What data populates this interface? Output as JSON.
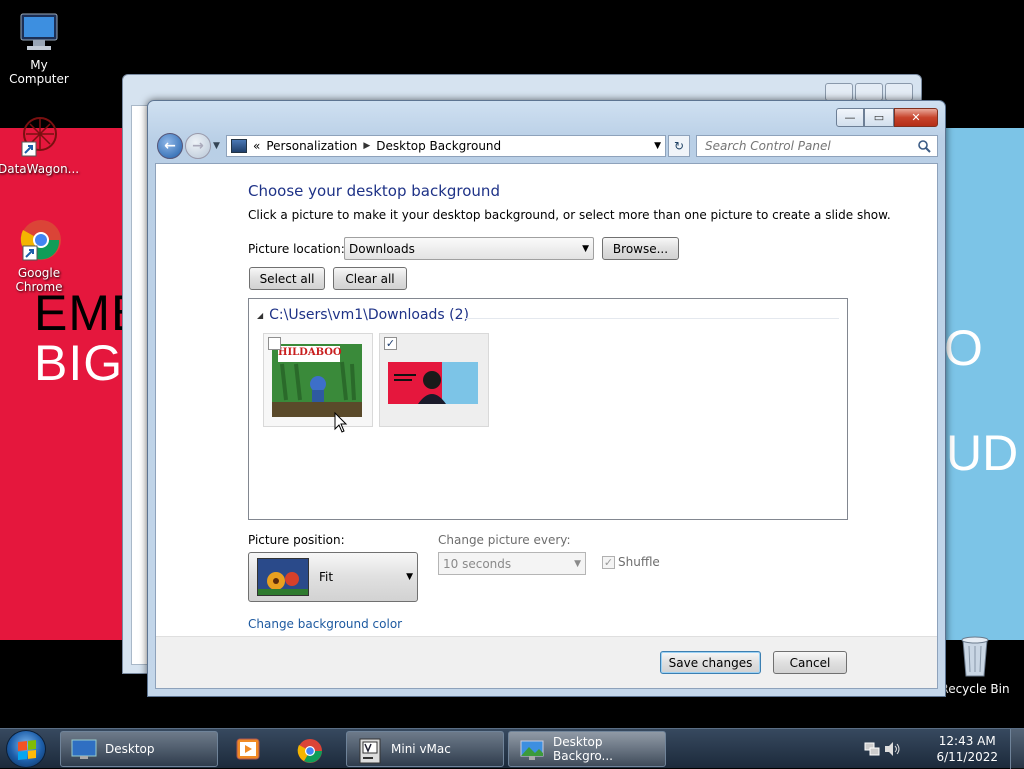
{
  "desktop": {
    "icons": [
      {
        "label": "My Computer",
        "icon": "computer-icon"
      },
      {
        "label": "DataWagon...",
        "icon": "shortcut-icon"
      },
      {
        "label": "Google Chrome",
        "icon": "chrome-icon"
      },
      {
        "label": "Recycle Bin",
        "icon": "recycle-bin-icon"
      }
    ],
    "wallpaper_left": {
      "line1": "EMB",
      "line2": "BIG",
      "color": "#e5173d"
    },
    "wallpaper_right": {
      "line1": "O",
      "line2": "UD",
      "color": "#7cc4e7"
    }
  },
  "window": {
    "caption_buttons": {
      "minimize": "—",
      "maximize": "▭",
      "close": "✕"
    },
    "breadcrumb": {
      "prefix": "«",
      "items": [
        "Personalization",
        "Desktop Background"
      ],
      "separator": "▶"
    },
    "search_placeholder": "Search Control Panel",
    "heading": "Choose your desktop background",
    "description": "Click a picture to make it your desktop background, or select more than one picture to create a slide show.",
    "picture_location_label": "Picture location:",
    "picture_location_value": "Downloads",
    "browse_label": "Browse...",
    "select_all_label": "Select all",
    "clear_all_label": "Clear all",
    "group_header": "C:\\Users\\vm1\\Downloads (2)",
    "pictures": [
      {
        "title": "HILDABOO",
        "checked": false
      },
      {
        "title": "",
        "checked": true
      }
    ],
    "picture_position_label": "Picture position:",
    "picture_position_value": "Fit",
    "change_every_label": "Change picture every:",
    "change_every_value": "10 seconds",
    "shuffle_label": "Shuffle",
    "change_bg_color_link": "Change background color",
    "save_label": "Save changes",
    "cancel_label": "Cancel"
  },
  "taskbar": {
    "items": [
      {
        "label": "Desktop",
        "icon": "desktop-icon"
      },
      {
        "label": "",
        "icon": "media-player-icon"
      },
      {
        "label": "",
        "icon": "chrome-icon"
      },
      {
        "label": "Mini vMac",
        "icon": "mini-vmac-icon"
      },
      {
        "label": "Desktop Backgro...",
        "icon": "desktop-background-icon"
      }
    ],
    "time": "12:43 AM",
    "date": "6/11/2022"
  },
  "colors": {
    "accent_heading": "#1e3287",
    "link": "#1e5aa0",
    "taskbar": "#1c2a3b"
  }
}
